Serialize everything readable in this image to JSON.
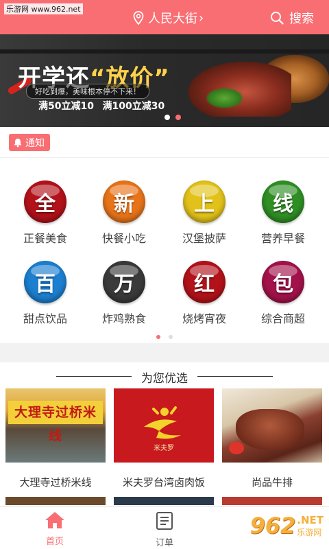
{
  "watermark_top": "乐游网 www.962.net",
  "header": {
    "location": "人民大街",
    "search_label": "搜索",
    "accent": "#f96e73"
  },
  "banner": {
    "title_pre": "开学还",
    "title_quote": "“放价”",
    "subtitle": "好吃到爆，美味根本停不下来！",
    "promo1": "满50立减10",
    "promo2": "满100立减30"
  },
  "notice": {
    "label": "通知"
  },
  "categories": [
    {
      "glyph": "全",
      "label": "正餐美食",
      "color": "#b3121a"
    },
    {
      "glyph": "新",
      "label": "快餐小吃",
      "color": "#e8741a"
    },
    {
      "glyph": "上",
      "label": "汉堡披萨",
      "color": "#e2c21a"
    },
    {
      "glyph": "线",
      "label": "营养早餐",
      "color": "#2f8f24"
    },
    {
      "glyph": "百",
      "label": "甜点饮品",
      "color": "#1c7fd0"
    },
    {
      "glyph": "万",
      "label": "炸鸡熟食",
      "color": "#3a3a3a"
    },
    {
      "glyph": "红",
      "label": "烧烤宵夜",
      "color": "#b3121a"
    },
    {
      "glyph": "包",
      "label": "综合商超",
      "color": "#a3124a"
    }
  ],
  "recommend": {
    "title": "为您优选",
    "items": [
      {
        "name": "大理寺过桥米线",
        "sign": "大理寺过桥米线"
      },
      {
        "name": "米夫罗台湾卤肉饭",
        "brand": "米夫罗"
      },
      {
        "name": "尚品牛排"
      }
    ]
  },
  "nav": {
    "home": "首页",
    "orders": "订单"
  },
  "watermark_br": {
    "big": "962",
    "net": ".NET",
    "site": "乐游网"
  }
}
